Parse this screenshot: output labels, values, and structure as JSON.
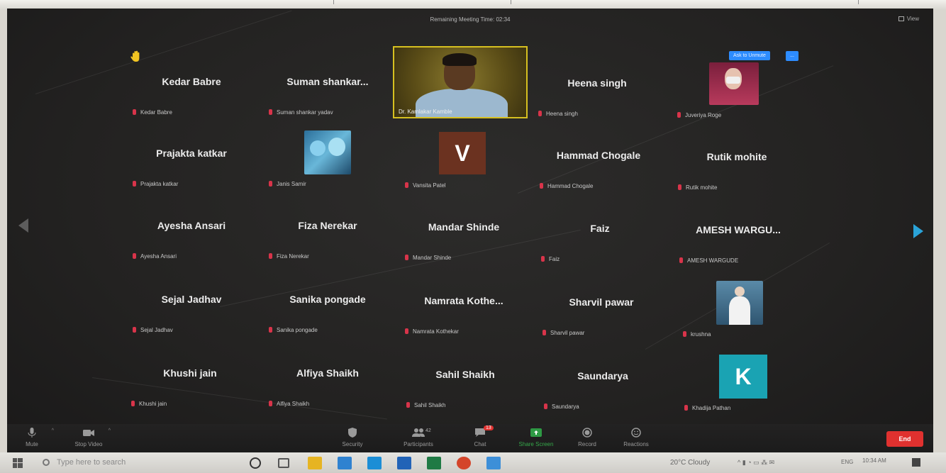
{
  "meeting": {
    "remaining_time": "Remaining Meeting Time: 02:34",
    "view_label": "View",
    "ask_to_unmute": "Ask to Unmute",
    "ask_more": "..."
  },
  "participants": [
    {
      "display": "Kedar Babre",
      "label": "Kedar Babre"
    },
    {
      "display": "Suman shankar...",
      "label": "Suman shankar yadav"
    },
    {
      "display": "",
      "label": "Dr. Kamlakar Kamble"
    },
    {
      "display": "Heena singh",
      "label": "Heena singh"
    },
    {
      "display": "",
      "label": "Juveriya Roge"
    },
    {
      "display": "Prajakta katkar",
      "label": "Prajakta katkar"
    },
    {
      "display": "",
      "label": "Janis Samir"
    },
    {
      "display": "V",
      "label": "Vansita Patel"
    },
    {
      "display": "Hammad Chogale",
      "label": "Hammad Chogale"
    },
    {
      "display": "Rutik mohite",
      "label": "Rutik mohite"
    },
    {
      "display": "Ayesha Ansari",
      "label": "Ayesha Ansari"
    },
    {
      "display": "Fiza Nerekar",
      "label": "Fiza Nerekar"
    },
    {
      "display": "Mandar Shinde",
      "label": "Mandar Shinde"
    },
    {
      "display": "Faiz",
      "label": "Faiz"
    },
    {
      "display": "AMESH WARGU...",
      "label": "AMESH WARGUDE"
    },
    {
      "display": "Sejal Jadhav",
      "label": "Sejal Jadhav"
    },
    {
      "display": "Sanika pongade",
      "label": "Sanika pongade"
    },
    {
      "display": "Namrata Kothe...",
      "label": "Namrata Kothekar"
    },
    {
      "display": "Sharvil pawar",
      "label": "Sharvil pawar"
    },
    {
      "display": "",
      "label": "krushna"
    },
    {
      "display": "Khushi jain",
      "label": "Khushi jain"
    },
    {
      "display": "Alfiya Shaikh",
      "label": "Alfiya Shaikh"
    },
    {
      "display": "Sahil Shaikh",
      "label": "Sahil Shaikh"
    },
    {
      "display": "Saundarya",
      "label": "Saundarya"
    },
    {
      "display": "K",
      "label": "Khadija Pathan"
    }
  ],
  "toolbar": {
    "mute": "Mute",
    "stop_video": "Stop Video",
    "security": "Security",
    "participants": "Participants",
    "participants_count": "42",
    "chat": "Chat",
    "chat_badge": "13",
    "share_screen": "Share Screen",
    "record": "Record",
    "reactions": "Reactions",
    "end": "End"
  },
  "taskbar": {
    "search_placeholder": "Type here to search",
    "weather": "20°C Cloudy",
    "lang": "ENG",
    "time": "10:34 AM"
  },
  "colors": {
    "active_speaker_border": "#d6c020",
    "v_avatar_bg": "#6b3220",
    "k_avatar_bg": "#1aa3b3",
    "end_button": "#e0312f",
    "accent_blue": "#2d8cff"
  }
}
